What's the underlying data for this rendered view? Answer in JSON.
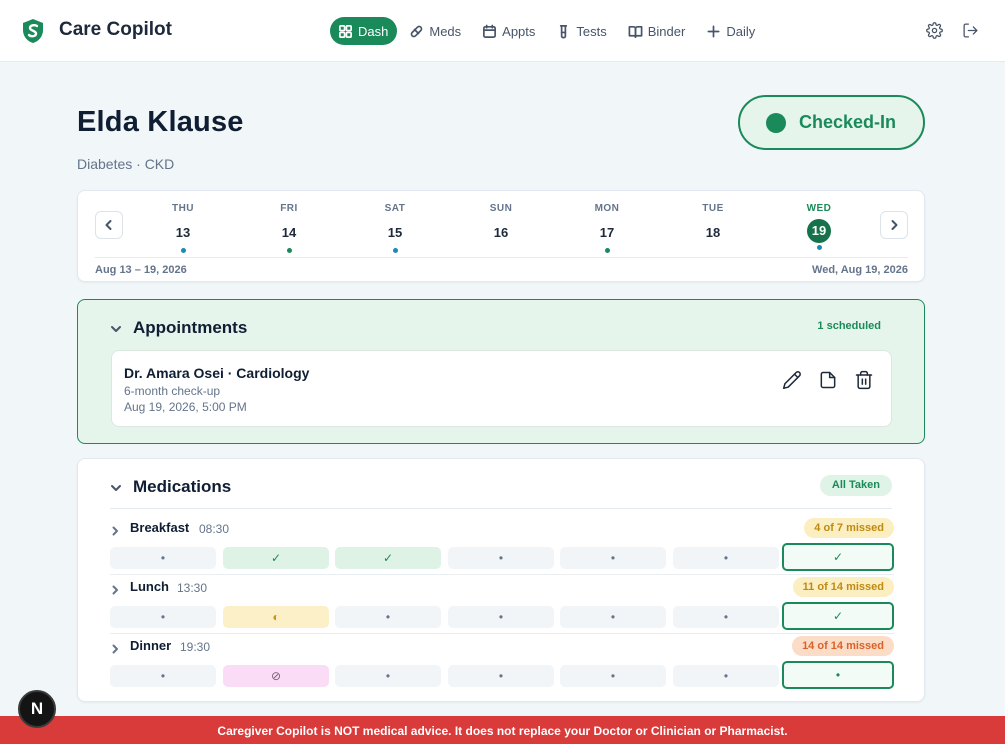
{
  "app": {
    "title": "Care Copilot"
  },
  "nav": [
    {
      "label": "Dash",
      "icon": "grid-icon",
      "active": true
    },
    {
      "label": "Meds",
      "icon": "pill-icon"
    },
    {
      "label": "Appts",
      "icon": "calendar-icon"
    },
    {
      "label": "Tests",
      "icon": "test-tube-icon"
    },
    {
      "label": "Binder",
      "icon": "book-icon"
    },
    {
      "label": "Daily",
      "icon": "plus-icon"
    }
  ],
  "patient": {
    "name": "Elda Klause",
    "conditions": "Diabetes · CKD",
    "status": "Checked-In"
  },
  "calendar": {
    "days": [
      {
        "name": "THU",
        "num": "13",
        "dot": "#1a8bb3"
      },
      {
        "name": "FRI",
        "num": "14",
        "dot": "#1b8a5a"
      },
      {
        "name": "SAT",
        "num": "15",
        "dot": "#1a8bb3"
      },
      {
        "name": "SUN",
        "num": "16",
        "dot": ""
      },
      {
        "name": "MON",
        "num": "17",
        "dot": "#1b8a5a"
      },
      {
        "name": "TUE",
        "num": "18",
        "dot": ""
      },
      {
        "name": "WED",
        "num": "19",
        "dot": "#1a8bb3",
        "current": true
      }
    ],
    "range": "Aug 13 – 19, 2026",
    "today": "Wed, Aug 19, 2026"
  },
  "appointments": {
    "title": "Appointments",
    "count": "1 scheduled",
    "items": [
      {
        "doctor": "Dr. Amara Osei · Cardiology",
        "reason": "6-month check-up",
        "time": "Aug 19, 2026, 5:00 PM"
      }
    ]
  },
  "medications": {
    "title": "Medications",
    "status": "All Taken",
    "meals": [
      {
        "name": "Breakfast",
        "time": "08:30",
        "badge": "4 of 7 missed",
        "badge_style": "warn",
        "cells": [
          {
            "state": "empty",
            "glyph": "•"
          },
          {
            "state": "taken",
            "glyph": "✓"
          },
          {
            "state": "taken",
            "glyph": "✓"
          },
          {
            "state": "empty",
            "glyph": "•"
          },
          {
            "state": "empty",
            "glyph": "•"
          },
          {
            "state": "empty",
            "glyph": "•"
          },
          {
            "state": "today",
            "glyph": "✓"
          }
        ]
      },
      {
        "name": "Lunch",
        "time": "13:30",
        "badge": "11 of 14 missed",
        "badge_style": "warn",
        "cells": [
          {
            "state": "empty",
            "glyph": "•"
          },
          {
            "state": "partial",
            "glyph": "◐"
          },
          {
            "state": "empty",
            "glyph": "•"
          },
          {
            "state": "empty",
            "glyph": "•"
          },
          {
            "state": "empty",
            "glyph": "•"
          },
          {
            "state": "empty",
            "glyph": "•"
          },
          {
            "state": "today",
            "glyph": "✓"
          }
        ]
      },
      {
        "name": "Dinner",
        "time": "19:30",
        "badge": "14 of 14 missed",
        "badge_style": "danger",
        "cells": [
          {
            "state": "empty",
            "glyph": "•"
          },
          {
            "state": "skipped",
            "glyph": "⊘"
          },
          {
            "state": "empty",
            "glyph": "•"
          },
          {
            "state": "empty",
            "glyph": "•"
          },
          {
            "state": "empty",
            "glyph": "•"
          },
          {
            "state": "empty",
            "glyph": "•"
          },
          {
            "state": "today",
            "glyph": "•"
          }
        ]
      }
    ]
  },
  "disclaimer": "Caregiver Copilot is NOT medical advice. It does not replace your Doctor or Clinician or Pharmacist.",
  "dev_badge": "N",
  "colors": {
    "brand": "#1b8a5a",
    "warn_bg": "#fbeec0",
    "warn_fg": "#c08a12",
    "danger_bg": "#fbdcc6",
    "danger_fg": "#d9622b",
    "alert": "#d93a3a"
  }
}
